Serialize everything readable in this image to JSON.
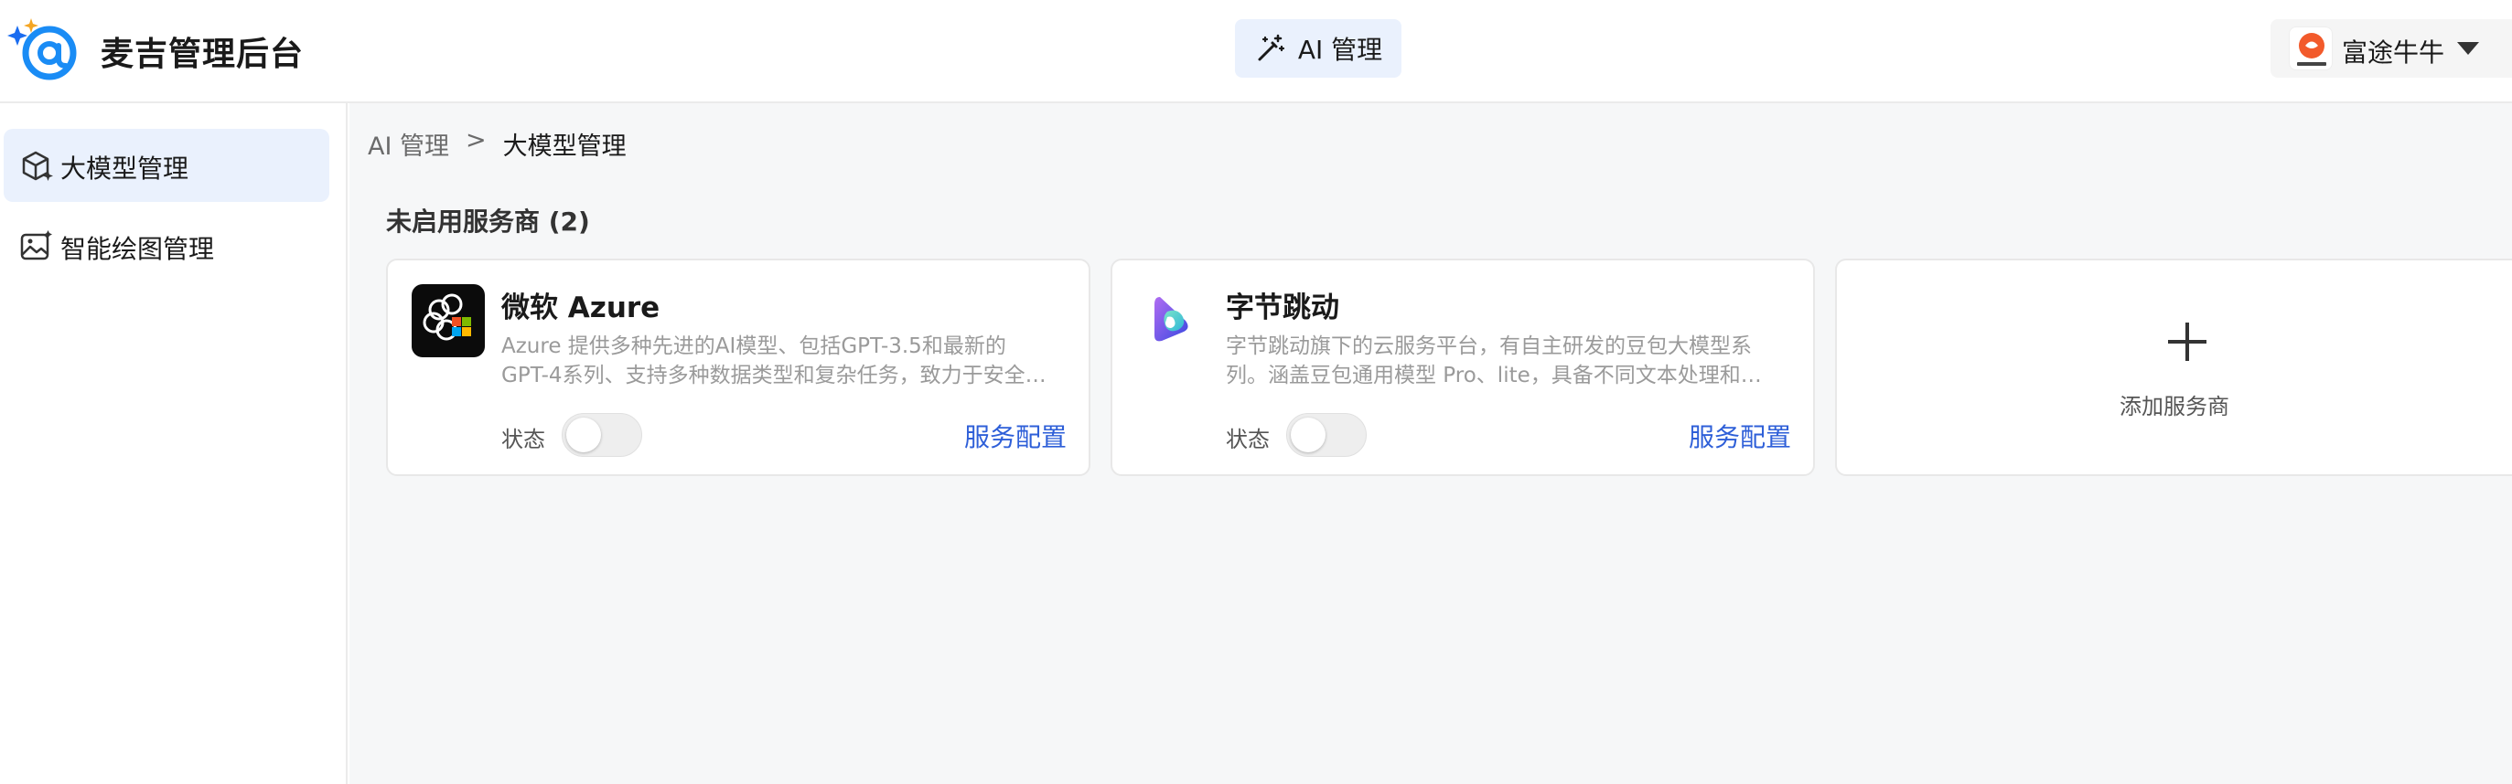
{
  "app": {
    "title": "麦吉管理后台",
    "logo_icon": "at-sign-sparkle-icon",
    "accent_color": "#1a6cf0"
  },
  "header": {
    "tab": {
      "label": "AI 管理",
      "icon": "magic-wand-icon"
    },
    "user": {
      "name": "富途牛牛",
      "avatar_icon": "futu-logo-icon"
    }
  },
  "sidebar": {
    "items": [
      {
        "label": "大模型管理",
        "icon": "cube-icon",
        "active": true
      },
      {
        "label": "智能绘图管理",
        "icon": "image-sparkle-icon",
        "active": false
      }
    ]
  },
  "breadcrumb": {
    "parent": "AI 管理",
    "separator": ">",
    "current": "大模型管理"
  },
  "section": {
    "title": "未启用服务商 (2)"
  },
  "providers": [
    {
      "name": "微软 Azure",
      "logo_icon": "azure-openai-icon",
      "description": "Azure 提供多种先进的AI模型、包括GPT-3.5和最新的GPT-4系列、支持多种数据类型和复杂任务，致力于安全、可靠和可持续的AI解决方案。",
      "status_label": "状态",
      "enabled": false,
      "config_label": "服务配置"
    },
    {
      "name": "字节跳动",
      "logo_icon": "doubao-icon",
      "description": "字节跳动旗下的云服务平台，有自主研发的豆包大模型系列。涵盖豆包通用模型 Pro、lite，具备不同文本处理和综合能力。",
      "status_label": "状态",
      "enabled": false,
      "config_label": "服务配置"
    }
  ],
  "add_provider": {
    "label": "添加服务商",
    "icon": "plus-icon"
  },
  "colors": {
    "link": "#2e5fd8",
    "active_bg": "#eaf1fd",
    "main_bg": "#f6f7f8"
  }
}
